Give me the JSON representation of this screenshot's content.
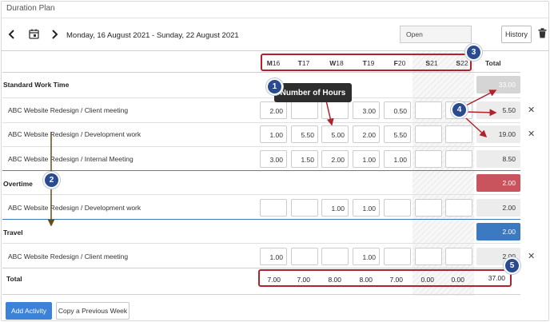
{
  "header": {
    "title": "Duration Plan",
    "date_range": "Monday, 16 August 2021 - Sunday, 22 August 2021",
    "status_value": "Open",
    "history_label": "History"
  },
  "days": [
    {
      "prefix": "M",
      "num": "16"
    },
    {
      "prefix": "T",
      "num": "17"
    },
    {
      "prefix": "W",
      "num": "18"
    },
    {
      "prefix": "T",
      "num": "19"
    },
    {
      "prefix": "F",
      "num": "20"
    },
    {
      "prefix": "S",
      "num": "21"
    },
    {
      "prefix": "S",
      "num": "22"
    }
  ],
  "total_header": "Total",
  "sections": {
    "standard": {
      "label": "Standard Work Time",
      "total": "33.00"
    },
    "overtime": {
      "label": "Overtime",
      "total": "2.00"
    },
    "travel": {
      "label": "Travel",
      "total": "2.00"
    }
  },
  "rows": [
    {
      "label": "ABC Website Redesign / Client meeting",
      "values": [
        "2.00",
        "",
        "",
        "3.00",
        "0.50",
        "",
        ""
      ],
      "total": "5.50"
    },
    {
      "label": "ABC Website Redesign / Development work",
      "values": [
        "1.00",
        "5.50",
        "5.00",
        "2.00",
        "5.50",
        "",
        ""
      ],
      "total": "19.00"
    },
    {
      "label": "ABC Website Redesign / Internal Meeting",
      "values": [
        "3.00",
        "1.50",
        "2.00",
        "1.00",
        "1.00",
        "",
        ""
      ],
      "total": "8.50"
    },
    {
      "label": "ABC Website Redesign / Development work",
      "values": [
        "",
        "",
        "1.00",
        "1.00",
        "",
        "",
        ""
      ],
      "total": "2.00"
    },
    {
      "label": "ABC Website Redesign / Client meeting",
      "values": [
        "1.00",
        "",
        "",
        "1.00",
        "",
        "",
        ""
      ],
      "total": "2.00"
    }
  ],
  "grand_total": {
    "label": "Total",
    "values": [
      "7.00",
      "7.00",
      "8.00",
      "8.00",
      "7.00",
      "0.00",
      "0.00"
    ],
    "total": "37.00"
  },
  "footer": {
    "add_activity": "Add Activity",
    "copy_week": "Copy a Previous Week"
  },
  "annotations": {
    "tooltip": "Number of Hours",
    "badges": [
      "1",
      "2",
      "3",
      "4",
      "5"
    ]
  },
  "colors": {
    "accent_red": "#b0232e",
    "badge_blue": "#2a4b8f",
    "overtime": "#c9545e",
    "travel": "#3b79c0",
    "primary": "#3d82d9",
    "arrow_brown": "#6b4a1a"
  }
}
